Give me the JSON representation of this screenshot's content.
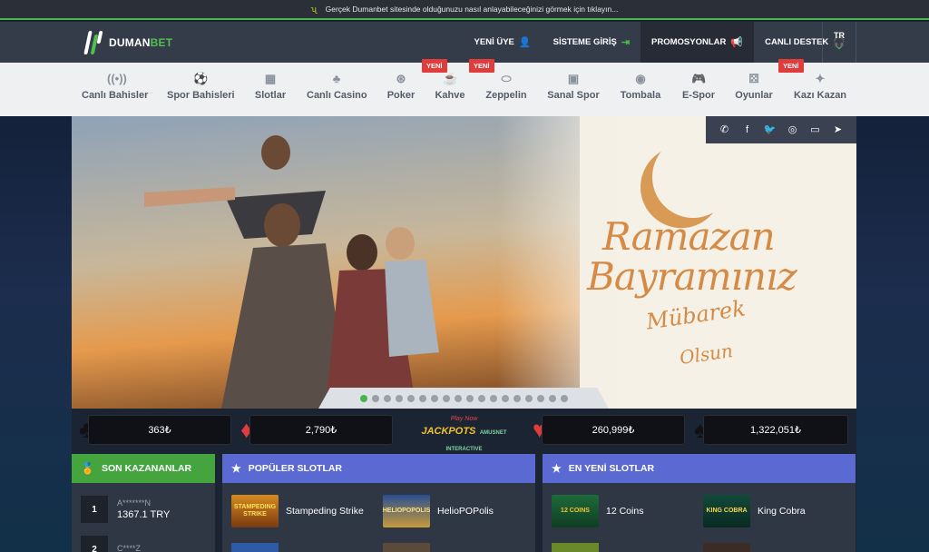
{
  "topbar": {
    "notice": "Gerçek Dumanbet sitesinde olduğunuzu nasıl anlayabileceğinizi görmek için tıklayın..."
  },
  "brand": {
    "logo_text_a": "DUMAN",
    "logo_text_b": "BET",
    "accent": "#46b34b"
  },
  "header": {
    "items": [
      {
        "label": "YENİ ÜYE",
        "icon": "user-icon"
      },
      {
        "label": "SİSTEME GİRİŞ",
        "icon": "login-icon"
      },
      {
        "label": "PROMOSYONLAR",
        "icon": "megaphone-icon"
      },
      {
        "label": "CANLI DESTEK",
        "icon": "headset-icon"
      }
    ],
    "lang": "TR"
  },
  "subnav": [
    {
      "label": "Canlı Bahisler",
      "icon": "broadcast-icon",
      "badge": ""
    },
    {
      "label": "Spor Bahisleri",
      "icon": "football-icon",
      "badge": ""
    },
    {
      "label": "Slotlar",
      "icon": "slot-machine-icon",
      "badge": ""
    },
    {
      "label": "Canlı Casino",
      "icon": "casino-icon",
      "badge": ""
    },
    {
      "label": "Poker",
      "icon": "poker-chip-icon",
      "badge": ""
    },
    {
      "label": "Kahve",
      "icon": "coffee-icon",
      "badge": "YENİ"
    },
    {
      "label": "Zeppelin",
      "icon": "zeppelin-icon",
      "badge": "YENİ"
    },
    {
      "label": "Sanal Spor",
      "icon": "tv-icon",
      "badge": ""
    },
    {
      "label": "Tombala",
      "icon": "tombala-icon",
      "badge": ""
    },
    {
      "label": "E-Spor",
      "icon": "gamepad-icon",
      "badge": ""
    },
    {
      "label": "Oyunlar",
      "icon": "dice-icon",
      "badge": ""
    },
    {
      "label": "Kazı Kazan",
      "icon": "scratch-icon",
      "badge": "YENİ"
    }
  ],
  "banner": {
    "line1": "Ramazan",
    "line2": "Bayramınız",
    "line3": "Mübarek",
    "line4": "Olsun",
    "slides_total": 18,
    "active_slide": 1
  },
  "social": [
    "whatsapp-icon",
    "facebook-icon",
    "twitter-icon",
    "instagram-icon",
    "tv-icon",
    "telegram-icon"
  ],
  "jackpots": {
    "values": [
      "363₺",
      "2,790₺",
      "260,999₺",
      "1,322,051₺"
    ],
    "logo_top": "Play Now",
    "logo_main": "JACKPOTS",
    "logo_brand": "AMUSNET INTERACTIVE"
  },
  "winners": {
    "title": "SON KAZANANLAR",
    "rows": [
      {
        "rank": "1",
        "name": "A*******N",
        "amount": "1367.1 TRY"
      },
      {
        "rank": "2",
        "name": "C****Z",
        "amount": ""
      }
    ]
  },
  "popular": {
    "title": "POPÜLER SLOTLAR",
    "games": [
      {
        "name": "Stampeding Strike",
        "thumb": "STAMPEDING STRIKE"
      },
      {
        "name": "HelioPOPolis",
        "thumb": "HELIOPOPOLIS"
      }
    ]
  },
  "newest": {
    "title": "EN YENİ SLOTLAR",
    "games": [
      {
        "name": "12 Coins",
        "thumb": "12 COINS"
      },
      {
        "name": "King Cobra",
        "thumb": "KING COBRA"
      }
    ]
  }
}
